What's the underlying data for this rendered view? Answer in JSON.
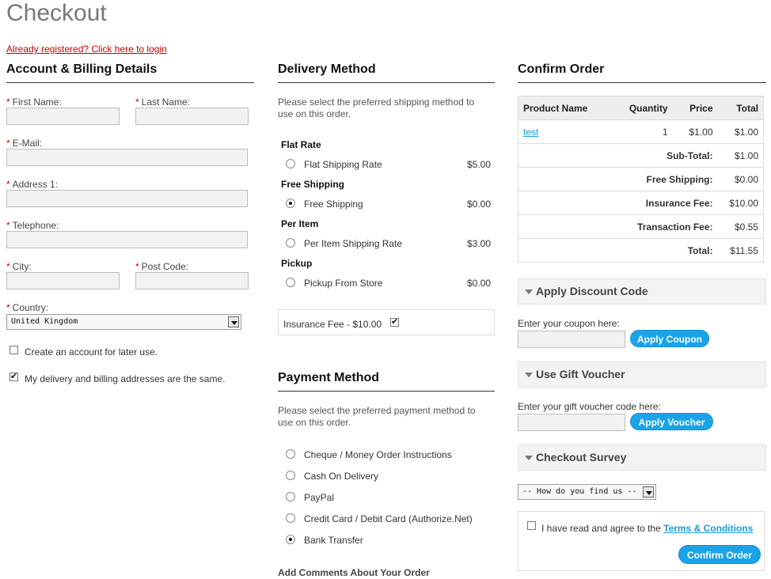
{
  "page_title": "Checkout",
  "login_link": "Already registered? Click here to login",
  "account": {
    "heading": "Account & Billing Details",
    "required_mark": "*",
    "first_name_label": "First Name:",
    "last_name_label": "Last Name:",
    "email_label": "E-Mail:",
    "address1_label": "Address 1:",
    "telephone_label": "Telephone:",
    "city_label": "City:",
    "post_code_label": "Post Code:",
    "country_label": "Country:",
    "country_value": "United Kingdom",
    "create_account_label": "Create an account for later use.",
    "create_account_checked": false,
    "same_address_label": "My delivery and billing addresses are the same.",
    "same_address_checked": true
  },
  "delivery": {
    "heading": "Delivery Method",
    "description": "Please select the preferred shipping method to use on this order.",
    "groups": [
      {
        "title": "Flat Rate",
        "option": "Flat Shipping Rate",
        "price": "$5.00",
        "selected": false
      },
      {
        "title": "Free Shipping",
        "option": "Free Shipping",
        "price": "$0.00",
        "selected": true
      },
      {
        "title": "Per Item",
        "option": "Per Item Shipping Rate",
        "price": "$3.00",
        "selected": false
      },
      {
        "title": "Pickup",
        "option": "Pickup From Store",
        "price": "$0.00",
        "selected": false
      }
    ],
    "insurance_label": "Insurance Fee - $10.00",
    "insurance_checked": true
  },
  "payment": {
    "heading": "Payment Method",
    "description": "Please select the preferred payment method to use on this order.",
    "options": [
      {
        "label": "Cheque / Money Order Instructions",
        "selected": false
      },
      {
        "label": "Cash On Delivery",
        "selected": false
      },
      {
        "label": "PayPal",
        "selected": false
      },
      {
        "label": "Credit Card / Debit Card (Authorize.Net)",
        "selected": false
      },
      {
        "label": "Bank Transfer",
        "selected": true
      }
    ],
    "comments_heading": "Add Comments About Your Order"
  },
  "confirm": {
    "heading": "Confirm Order",
    "columns": [
      "Product Name",
      "Quantity",
      "Price",
      "Total"
    ],
    "product": {
      "name": "test",
      "quantity": "1",
      "price": "$1.00",
      "total": "$1.00"
    },
    "totals": [
      {
        "label": "Sub-Total:",
        "value": "$1.00"
      },
      {
        "label": "Free Shipping:",
        "value": "$0.00"
      },
      {
        "label": "Insurance Fee:",
        "value": "$10.00"
      },
      {
        "label": "Transaction Fee:",
        "value": "$0.55"
      },
      {
        "label": "Total:",
        "value": "$11.55"
      }
    ]
  },
  "discount": {
    "heading": "Apply Discount Code",
    "label": "Enter your coupon here:",
    "button": "Apply Coupon"
  },
  "voucher": {
    "heading": "Use Gift Voucher",
    "label": "Enter your gift voucher code here:",
    "button": "Apply Voucher"
  },
  "survey": {
    "heading": "Checkout Survey",
    "selected": "-- How do you find us --"
  },
  "terms": {
    "text": "I have read and agree to the",
    "link": "Terms & Conditions",
    "checked": false
  },
  "confirm_button": "Confirm Order",
  "colors": {
    "accent": "#1aa3e8",
    "link_red": "#cc0000",
    "link_blue": "#1a9ad6"
  }
}
